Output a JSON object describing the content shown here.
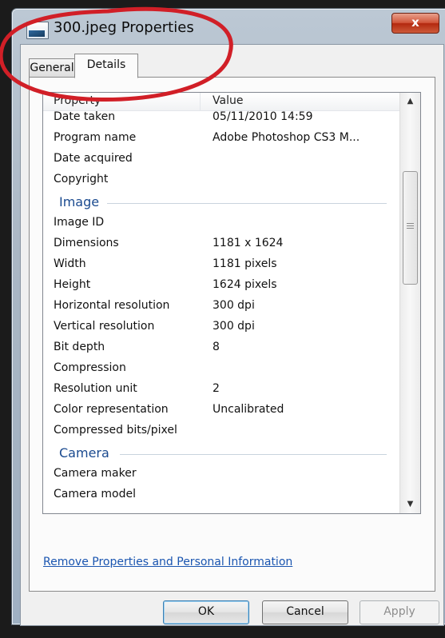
{
  "window": {
    "title": "300.jpeg Properties",
    "close_label": "x"
  },
  "tabs": [
    {
      "label": "General",
      "selected": false
    },
    {
      "label": "Details",
      "selected": true
    }
  ],
  "list": {
    "header_property": "Property",
    "header_value": "Value",
    "rows_top": [
      {
        "property": "Date taken",
        "value": "05/11/2010 14:59"
      },
      {
        "property": "Program name",
        "value": "Adobe Photoshop CS3 M..."
      },
      {
        "property": "Date acquired",
        "value": ""
      },
      {
        "property": "Copyright",
        "value": ""
      }
    ],
    "image_group": "Image",
    "image_rows": [
      {
        "property": "Image ID",
        "value": ""
      },
      {
        "property": "Dimensions",
        "value": "1181 x 1624"
      },
      {
        "property": "Width",
        "value": "1181 pixels"
      },
      {
        "property": "Height",
        "value": "1624 pixels"
      },
      {
        "property": "Horizontal resolution",
        "value": "300 dpi"
      },
      {
        "property": "Vertical resolution",
        "value": "300 dpi"
      },
      {
        "property": "Bit depth",
        "value": "8"
      },
      {
        "property": "Compression",
        "value": ""
      },
      {
        "property": "Resolution unit",
        "value": "2"
      },
      {
        "property": "Color representation",
        "value": "Uncalibrated"
      },
      {
        "property": "Compressed bits/pixel",
        "value": ""
      }
    ],
    "camera_group": "Camera",
    "camera_rows": [
      {
        "property": "Camera maker",
        "value": ""
      },
      {
        "property": "Camera model",
        "value": ""
      }
    ]
  },
  "scrollbar": {
    "up_arrow": "▲",
    "down_arrow": "▼"
  },
  "link": "Remove Properties and Personal Information",
  "buttons": {
    "ok": "OK",
    "cancel": "Cancel",
    "apply": "Apply"
  },
  "colors": {
    "annotation_circle": "#d11f27",
    "group_title": "#1a4a8f",
    "link": "#1a55b0"
  }
}
